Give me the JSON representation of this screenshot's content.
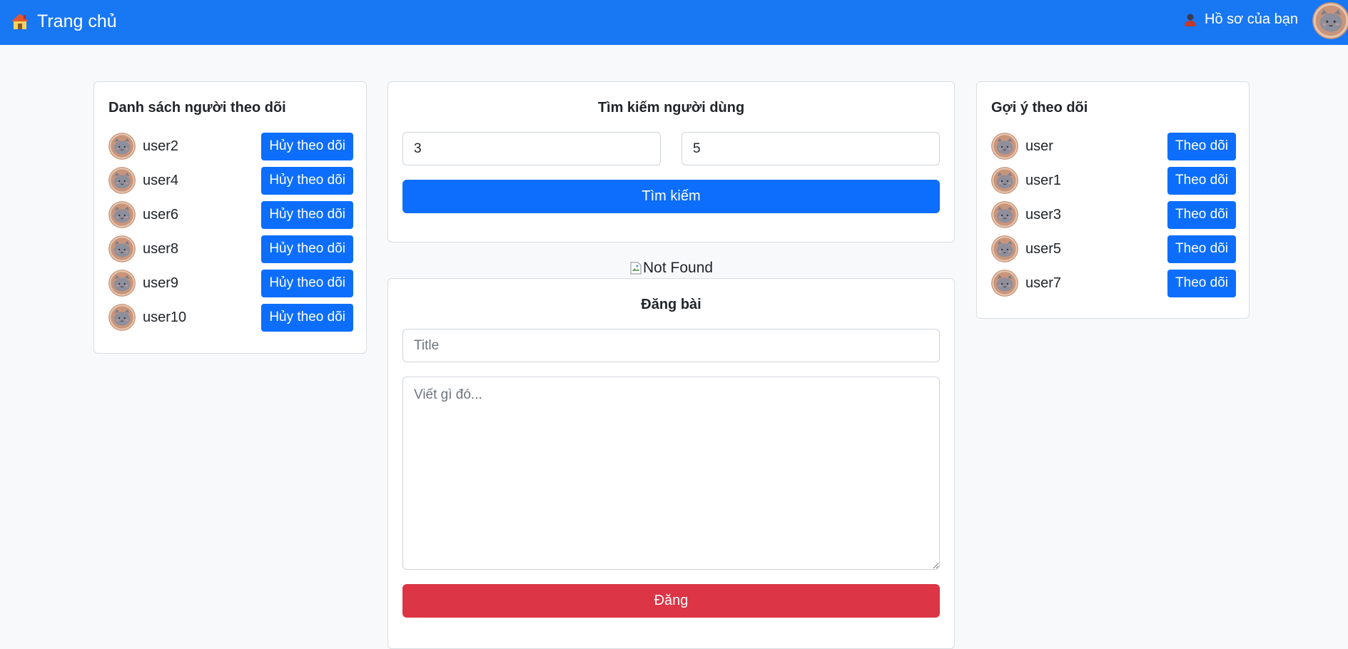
{
  "navbar": {
    "brand_label": "Trang chủ",
    "brand_icon": "house-icon",
    "profile_label": "Hồ sơ của bạn",
    "profile_icon": "person-icon",
    "accent_color": "#1877f2"
  },
  "following": {
    "title": "Danh sách người theo dõi",
    "users": [
      {
        "name": "user2",
        "button": "Hủy theo dõi"
      },
      {
        "name": "user4",
        "button": "Hủy theo dõi"
      },
      {
        "name": "user6",
        "button": "Hủy theo dõi"
      },
      {
        "name": "user8",
        "button": "Hủy theo dõi"
      },
      {
        "name": "user9",
        "button": "Hủy theo dõi"
      },
      {
        "name": "user10",
        "button": "Hủy theo dõi"
      }
    ]
  },
  "search": {
    "title": "Tìm kiếm người dùng",
    "input1_value": "3",
    "input2_value": "5",
    "button_label": "Tìm kiếm",
    "button_color": "#0d6efd"
  },
  "broken_image": {
    "alt_text": "Not Found"
  },
  "post": {
    "title": "Đăng bài",
    "title_placeholder": "Title",
    "body_placeholder": "Viết gì đó...",
    "submit_label": "Đăng",
    "submit_color": "#dc3545"
  },
  "suggestions": {
    "title": "Gợi ý theo dõi",
    "users": [
      {
        "name": "user",
        "button": "Theo dõi"
      },
      {
        "name": "user1",
        "button": "Theo dõi"
      },
      {
        "name": "user3",
        "button": "Theo dõi"
      },
      {
        "name": "user5",
        "button": "Theo dõi"
      },
      {
        "name": "user7",
        "button": "Theo dõi"
      }
    ]
  }
}
